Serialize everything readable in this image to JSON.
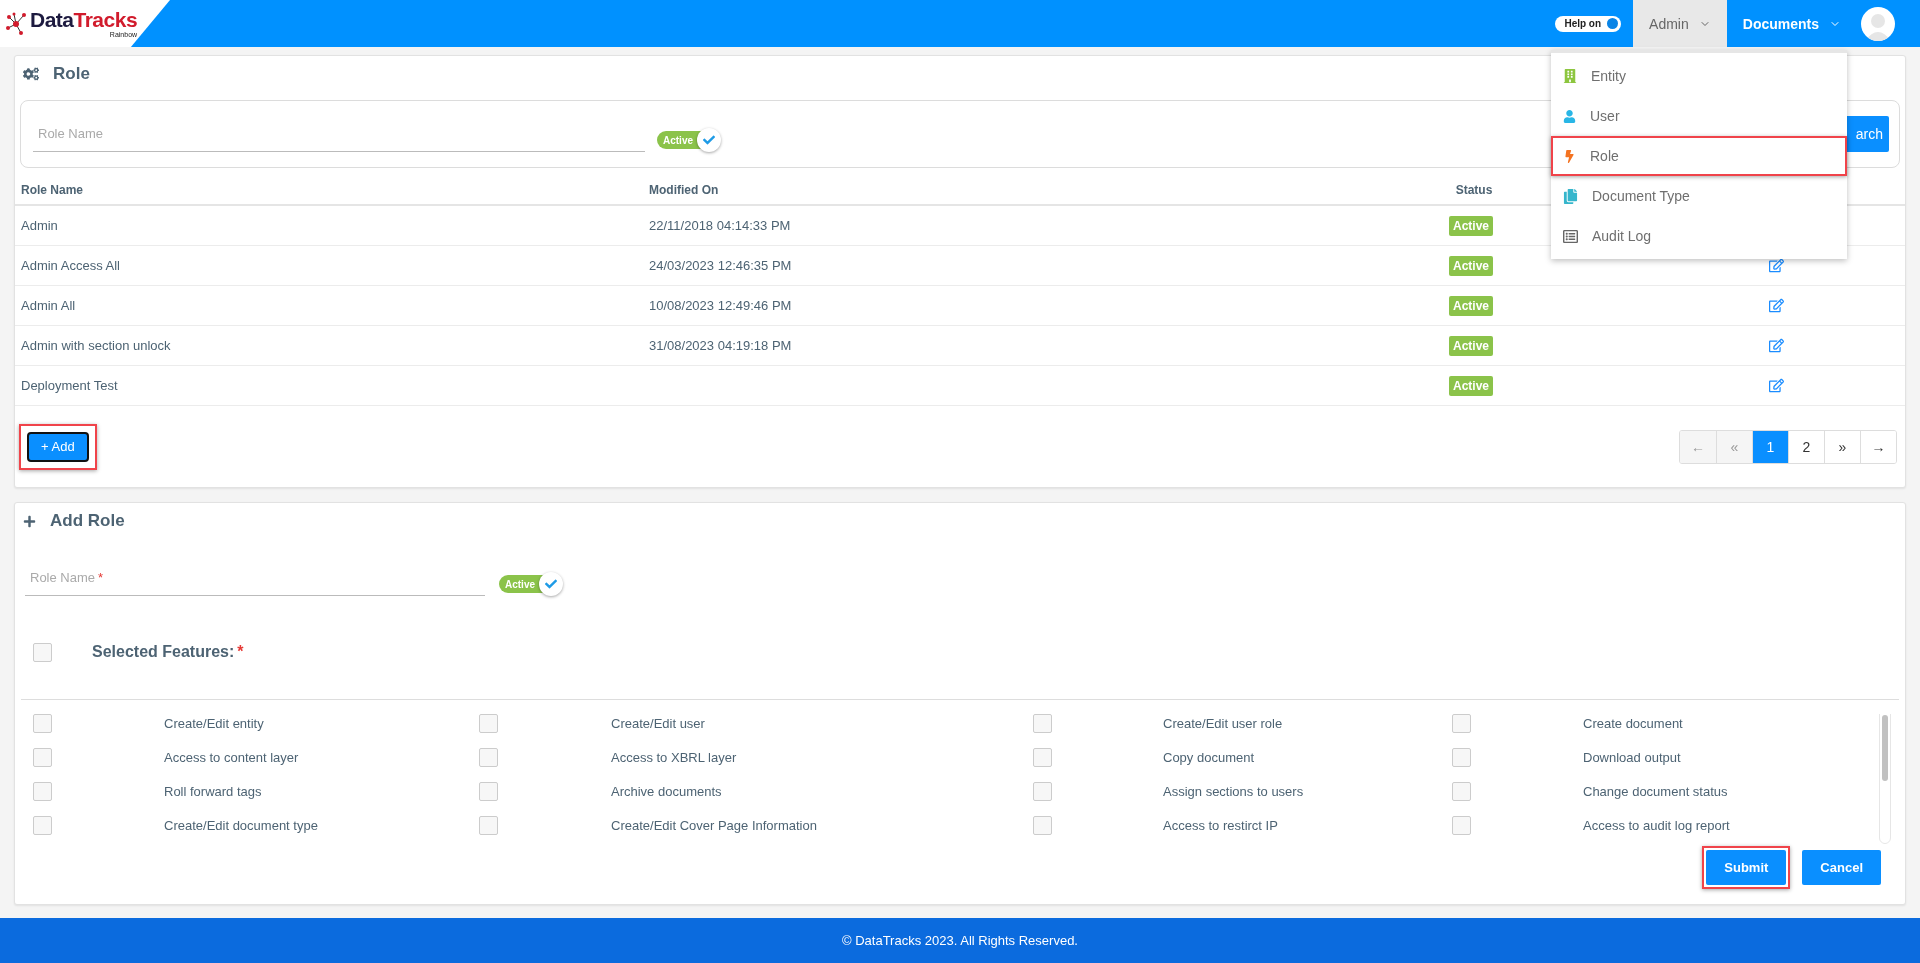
{
  "header": {
    "logo": {
      "name_part_1": "Data",
      "name_part_2": "Tracks",
      "tagline": "Rainbow"
    },
    "help_toggle": {
      "label": "Help on",
      "on": true
    },
    "nav": [
      {
        "label": "Admin",
        "selected": true
      },
      {
        "label": "Documents",
        "selected": false
      }
    ]
  },
  "admin_menu": [
    {
      "label": "Entity",
      "highlighted": false
    },
    {
      "label": "User",
      "highlighted": false
    },
    {
      "label": "Role",
      "highlighted": true
    },
    {
      "label": "Document Type",
      "highlighted": false
    },
    {
      "label": "Audit Log",
      "highlighted": false
    }
  ],
  "role_panel": {
    "title": "Role",
    "search": {
      "placeholder": "Role Name",
      "toggle": {
        "label": "Active",
        "on": true
      },
      "button": "arch"
    },
    "table": {
      "columns": [
        "Role Name",
        "Modified On",
        "Status"
      ],
      "rows": [
        {
          "name": "Admin",
          "modified_on": "22/11/2018 04:14:33 PM",
          "status": "Active"
        },
        {
          "name": "Admin Access All",
          "modified_on": "24/03/2023 12:46:35 PM",
          "status": "Active",
          "edit": true
        },
        {
          "name": "Admin All",
          "modified_on": "10/08/2023 12:49:46 PM",
          "status": "Active",
          "edit": true
        },
        {
          "name": "Admin with section unlock",
          "modified_on": "31/08/2023 04:19:18 PM",
          "status": "Active",
          "edit": true
        },
        {
          "name": "Deployment Test",
          "status": "Active",
          "edit": true
        }
      ]
    },
    "add_button": {
      "label": "+ Add",
      "highlighted": true
    },
    "pagination": [
      {
        "label": "←",
        "selected": false,
        "disabled": true
      },
      {
        "label": "«",
        "selected": false,
        "disabled": true
      },
      {
        "label": "1",
        "selected": true,
        "disabled": false
      },
      {
        "label": "2",
        "selected": false,
        "disabled": false
      },
      {
        "label": "»",
        "selected": false,
        "disabled": false
      },
      {
        "label": "→",
        "selected": false,
        "disabled": false
      }
    ]
  },
  "add_role_panel": {
    "title": "Add Role",
    "role_name": {
      "placeholder": "Role Name",
      "required_mark": "*"
    },
    "toggle": {
      "label": "Active",
      "on": true
    },
    "select_all": {
      "label": "Selected Features:",
      "required_mark": "*",
      "checked": false
    },
    "features": [
      {
        "label": "Create/Edit entity",
        "checked": false
      },
      {
        "label": "Create/Edit user",
        "checked": false
      },
      {
        "label": "Create/Edit user role",
        "checked": false
      },
      {
        "label": "Create document",
        "checked": false
      },
      {
        "label": "Access to content layer",
        "checked": false
      },
      {
        "label": "Access to XBRL layer",
        "checked": false
      },
      {
        "label": "Copy document",
        "checked": false
      },
      {
        "label": "Download output",
        "checked": false
      },
      {
        "label": "Roll forward tags",
        "checked": false
      },
      {
        "label": "Archive documents",
        "checked": false
      },
      {
        "label": "Assign sections to users",
        "checked": false
      },
      {
        "label": "Change document status",
        "checked": false
      },
      {
        "label": "Create/Edit document type",
        "checked": false
      },
      {
        "label": "Create/Edit Cover Page Information",
        "checked": false
      },
      {
        "label": "Access to restirct IP",
        "checked": false
      },
      {
        "label": "Access to audit log report",
        "checked": false
      }
    ],
    "buttons": [
      {
        "label": "Submit",
        "highlighted": true
      },
      {
        "label": "Cancel",
        "highlighted": false
      }
    ]
  },
  "footer": "© DataTracks 2023. All Rights Reserved."
}
